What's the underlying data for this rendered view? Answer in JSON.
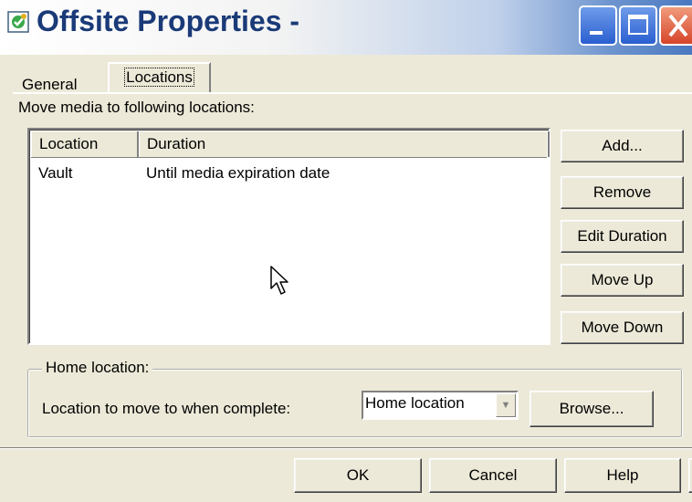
{
  "window": {
    "title": "Offsite Properties -",
    "icon": "offsite-app-icon",
    "controls": {
      "minimize": "minimize-icon",
      "maximize": "maximize-icon",
      "close": "close-icon"
    }
  },
  "tabs": [
    {
      "label": "General",
      "selected": false
    },
    {
      "label": "Locations",
      "selected": true
    }
  ],
  "main": {
    "caption": "Move media to following locations:",
    "table": {
      "columns": [
        "Location",
        "Duration"
      ],
      "rows": [
        {
          "location": "Vault",
          "duration": "Until media expiration date"
        }
      ]
    },
    "buttons": {
      "add": "Add...",
      "remove": "Remove",
      "edit_duration": "Edit Duration",
      "move_up": "Move Up",
      "move_down": "Move Down"
    }
  },
  "home": {
    "group_title": "Home location:",
    "label": "Location to move to when complete:",
    "combo_value": "Home location",
    "browse": "Browse..."
  },
  "footer": {
    "ok": "OK",
    "cancel": "Cancel",
    "help": "Help",
    "whats_this": "?"
  },
  "colors": {
    "title_text": "#1a3a78",
    "dialog_bg": "#ece9d8",
    "close_button": "#d6452a",
    "caption_buttons": "#2a5fd0"
  }
}
